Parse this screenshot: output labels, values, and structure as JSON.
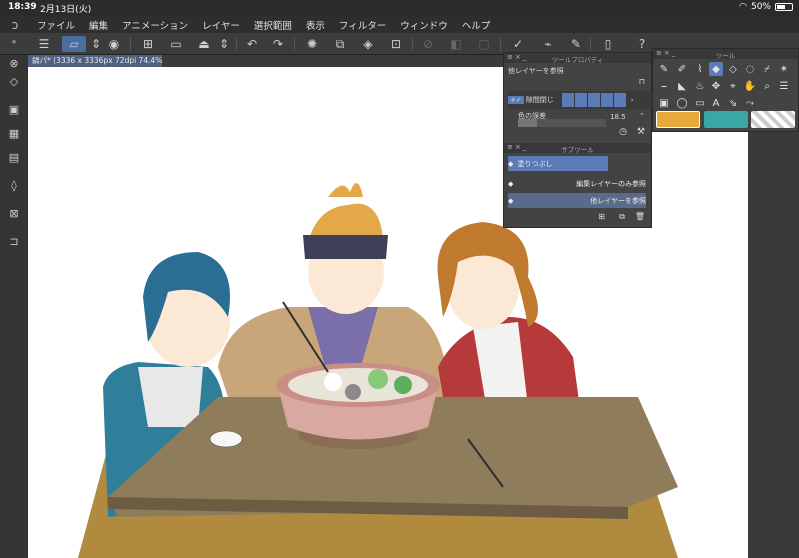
{
  "status_bar": {
    "time": "18:39",
    "date": "2月13日(火)",
    "battery": "50%",
    "battery_level": 0.5
  },
  "menu": {
    "items": [
      "ファイル",
      "編集",
      "アニメーション",
      "レイヤー",
      "選択範囲",
      "表示",
      "フィルター",
      "ウィンドウ",
      "ヘルプ"
    ]
  },
  "document": {
    "tab_title": "鍋パ* (3336 x 3336px 72dpi 74.4%)"
  },
  "tool_property": {
    "title": "ツールプロパティ",
    "refer_label": "他レイヤーを参照",
    "gap_close_label": "隙間閉じ",
    "color_margin_label": "色の誤差",
    "color_margin_value": "18.5"
  },
  "subtool": {
    "title": "サブツール",
    "items": [
      "塗りつぶし",
      "編集レイヤーのみ参照",
      "他レイヤーを参照"
    ]
  },
  "tool_palette": {
    "title": "ツール"
  },
  "colors": {
    "main": "#e8a93a",
    "sub": "#3aa6a6",
    "accent": "#4a6ea0"
  },
  "icons": {
    "cmdbar": [
      "menu-icon",
      "canvas-icon",
      "up-down-icon",
      "eye-icon",
      "new-file-icon",
      "open-icon",
      "save-icon",
      "up-down-icon",
      "undo-icon",
      "redo-icon",
      "loading-icon",
      "transform-icon",
      "fill-icon",
      "crop-icon",
      "select-all-icon",
      "layer-icon",
      "mask-icon",
      "pen-icon",
      "brush-icon",
      "pencil-icon",
      "device-icon",
      "help-icon"
    ]
  }
}
